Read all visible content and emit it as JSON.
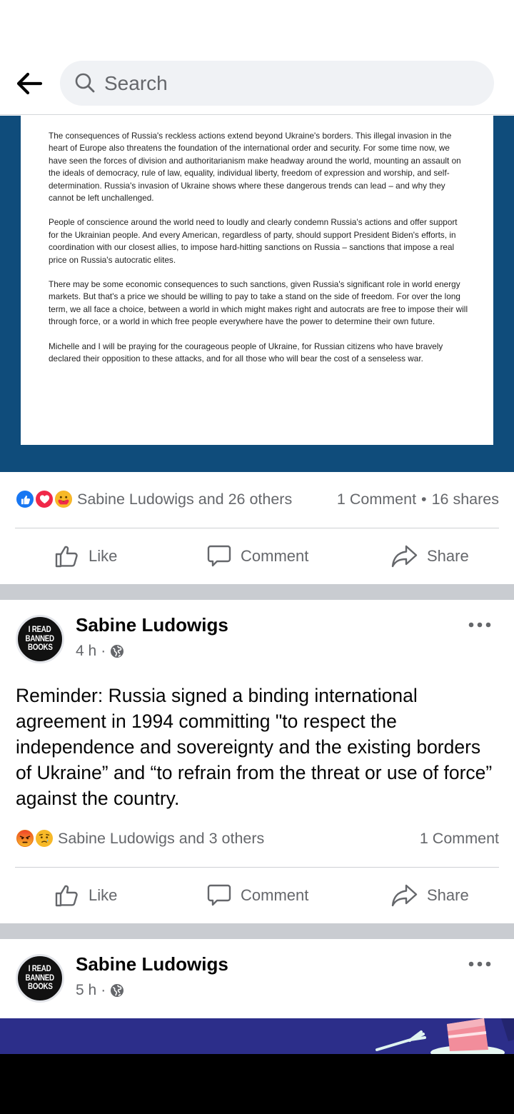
{
  "search": {
    "placeholder": "Search"
  },
  "shared_image": {
    "paragraphs": [
      "The consequences of Russia's reckless actions extend beyond Ukraine's borders. This illegal invasion in the heart of Europe also threatens the foundation of the international order and security. For some time now, we have seen the forces of division and authoritarianism make headway around the world, mounting an assault on the ideals of democracy, rule of law, equality, individual liberty, freedom of expression and worship, and self-determination. Russia's invasion of Ukraine shows where these dangerous trends can lead – and why they cannot be left unchallenged.",
      "People of conscience around the world need to loudly and clearly condemn Russia's actions and offer support for the Ukrainian people. And every American, regardless of party, should support President Biden's efforts, in coordination with our closest allies, to impose hard-hitting sanctions on Russia – sanctions that impose a real price on Russia's autocratic elites.",
      "There may be some economic consequences to such sanctions, given Russia's significant role in world energy markets. But that's a price we should be willing to pay to take a stand on the side of freedom. For over the long term, we all face a choice, between a world in which might makes right and autocrats are free to impose their will through force, or a world in which free people everywhere have the power to determine their own future.",
      "Michelle and I will be praying for the courageous people of Ukraine, for Russian citizens who have bravely declared their opposition to these attacks, and for all those who will bear the cost of a senseless war."
    ],
    "reactions": [
      "like-reaction",
      "love-reaction",
      "care-reaction"
    ],
    "reactions_text": "Sabine Ludowigs and 26 others",
    "comments": "1 Comment",
    "shares": "16 shares",
    "separator": "•"
  },
  "actions": {
    "like": "Like",
    "comment": "Comment",
    "share": "Share"
  },
  "posts": [
    {
      "avatar_lines": [
        "I READ",
        "BANNED",
        "BOOKS"
      ],
      "author": "Sabine Ludowigs",
      "time": "4 h",
      "meta_dot": "·",
      "text": "Reminder: Russia signed a binding international agreement in 1994 committing \"to respect the independence and sovereignty and the existing borders of Ukraine” and “to refrain from the threat or use of force” against the country.",
      "reactions": [
        "angry-reaction",
        "sad-reaction"
      ],
      "reactions_text": "Sabine Ludowigs and 3 others",
      "comments": "1 Comment"
    },
    {
      "avatar_lines": [
        "I READ",
        "BANNED",
        "BOOKS"
      ],
      "author": "Sabine Ludowigs",
      "time": "5 h",
      "meta_dot": "·"
    }
  ],
  "colors": {
    "brand_blue": "#1877f2",
    "doc_background": "#0f4c7b",
    "secondary_text": "#65676b",
    "separator_band": "#c9ccd1"
  }
}
